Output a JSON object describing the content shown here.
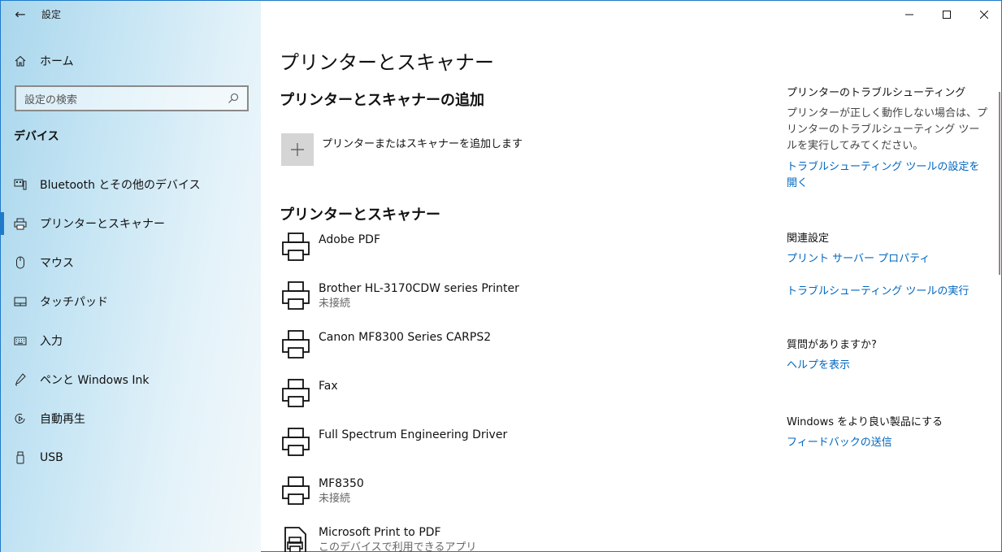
{
  "window": {
    "title": "設定",
    "back_icon": "←",
    "minimize_icon": "—",
    "maximize_icon": "☐",
    "close_icon": "✕"
  },
  "sidebar": {
    "home_label": "ホーム",
    "search_placeholder": "設定の検索",
    "section_title": "デバイス",
    "items": [
      {
        "label": "Bluetooth とその他のデバイス",
        "icon": "devices-icon",
        "glyph": "⌨"
      },
      {
        "label": "プリンターとスキャナー",
        "icon": "printer-icon",
        "glyph": "⎙"
      },
      {
        "label": "マウス",
        "icon": "mouse-icon",
        "glyph": "◯"
      },
      {
        "label": "タッチパッド",
        "icon": "touchpad-icon",
        "glyph": "▭"
      },
      {
        "label": "入力",
        "icon": "keyboard-icon",
        "glyph": "⌨"
      },
      {
        "label": "ペンと Windows Ink",
        "icon": "pen-icon",
        "glyph": "✎"
      },
      {
        "label": "自動再生",
        "icon": "autoplay-icon",
        "glyph": "⟳"
      },
      {
        "label": "USB",
        "icon": "usb-icon",
        "glyph": "▯"
      }
    ],
    "active_index": 1,
    "accent_color": "#1f7ac9"
  },
  "main": {
    "title": "プリンターとスキャナー",
    "add_section_title": "プリンターとスキャナーの追加",
    "add_button_label": "プリンターまたはスキャナーを追加します",
    "list_title": "プリンターとスキャナー",
    "printers": [
      {
        "name": "Adobe PDF",
        "status": ""
      },
      {
        "name": "Brother HL-3170CDW series Printer",
        "status": "未接続"
      },
      {
        "name": "Canon MF8300 Series CARPS2",
        "status": ""
      },
      {
        "name": "Fax",
        "status": ""
      },
      {
        "name": "Full Spectrum Engineering Driver",
        "status": ""
      },
      {
        "name": "MF8350",
        "status": "未接続"
      },
      {
        "name": "Microsoft Print to PDF",
        "status": "このデバイスで利用できるアプリ"
      }
    ]
  },
  "right": {
    "troubleshoot_title": "プリンターのトラブルシューティング",
    "troubleshoot_text": "プリンターが正しく動作しない場合は、プリンターのトラブルシューティング ツールを実行してみてください。",
    "troubleshoot_link": "トラブルシューティング ツールの設定を開く",
    "related_title": "関連設定",
    "related_link_1": "プリント サーバー プロパティ",
    "related_link_2": "トラブルシューティング ツールの実行",
    "question_title": "質問がありますか?",
    "help_link": "ヘルプを表示",
    "feedback_title": "Windows をより良い製品にする",
    "feedback_link": "フィードバックの送信",
    "link_color": "#0067c0"
  }
}
